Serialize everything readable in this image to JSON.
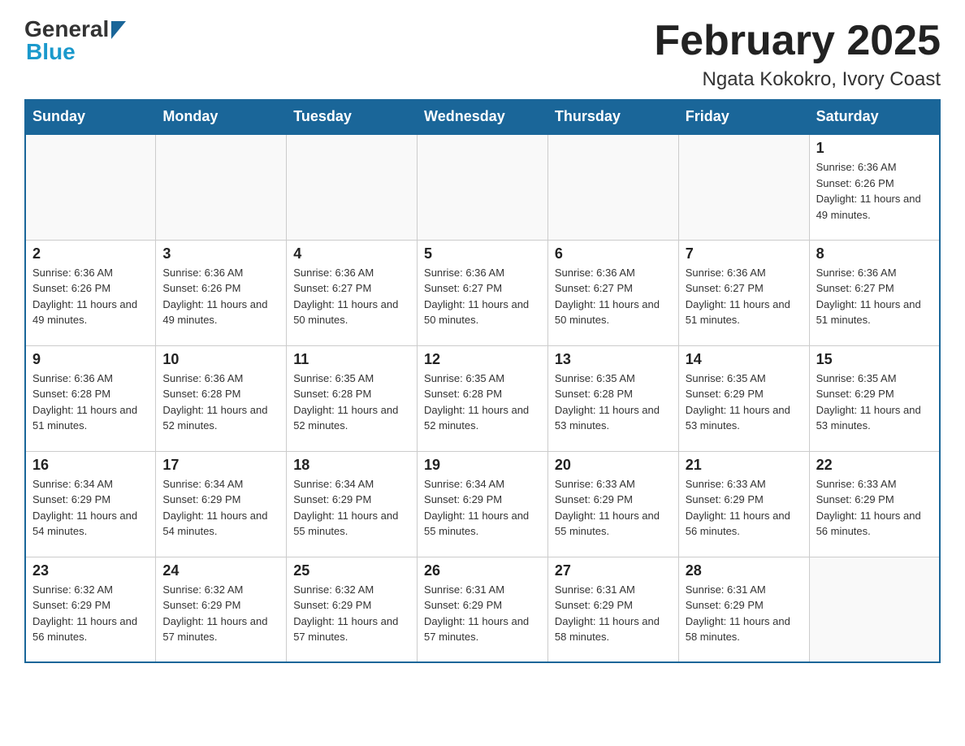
{
  "header": {
    "title": "February 2025",
    "location": "Ngata Kokokro, Ivory Coast"
  },
  "logo": {
    "general": "General",
    "blue": "Blue"
  },
  "days_of_week": [
    "Sunday",
    "Monday",
    "Tuesday",
    "Wednesday",
    "Thursday",
    "Friday",
    "Saturday"
  ],
  "weeks": [
    {
      "days": [
        {
          "number": "",
          "info": ""
        },
        {
          "number": "",
          "info": ""
        },
        {
          "number": "",
          "info": ""
        },
        {
          "number": "",
          "info": ""
        },
        {
          "number": "",
          "info": ""
        },
        {
          "number": "",
          "info": ""
        },
        {
          "number": "1",
          "info": "Sunrise: 6:36 AM\nSunset: 6:26 PM\nDaylight: 11 hours and 49 minutes."
        }
      ]
    },
    {
      "days": [
        {
          "number": "2",
          "info": "Sunrise: 6:36 AM\nSunset: 6:26 PM\nDaylight: 11 hours and 49 minutes."
        },
        {
          "number": "3",
          "info": "Sunrise: 6:36 AM\nSunset: 6:26 PM\nDaylight: 11 hours and 49 minutes."
        },
        {
          "number": "4",
          "info": "Sunrise: 6:36 AM\nSunset: 6:27 PM\nDaylight: 11 hours and 50 minutes."
        },
        {
          "number": "5",
          "info": "Sunrise: 6:36 AM\nSunset: 6:27 PM\nDaylight: 11 hours and 50 minutes."
        },
        {
          "number": "6",
          "info": "Sunrise: 6:36 AM\nSunset: 6:27 PM\nDaylight: 11 hours and 50 minutes."
        },
        {
          "number": "7",
          "info": "Sunrise: 6:36 AM\nSunset: 6:27 PM\nDaylight: 11 hours and 51 minutes."
        },
        {
          "number": "8",
          "info": "Sunrise: 6:36 AM\nSunset: 6:27 PM\nDaylight: 11 hours and 51 minutes."
        }
      ]
    },
    {
      "days": [
        {
          "number": "9",
          "info": "Sunrise: 6:36 AM\nSunset: 6:28 PM\nDaylight: 11 hours and 51 minutes."
        },
        {
          "number": "10",
          "info": "Sunrise: 6:36 AM\nSunset: 6:28 PM\nDaylight: 11 hours and 52 minutes."
        },
        {
          "number": "11",
          "info": "Sunrise: 6:35 AM\nSunset: 6:28 PM\nDaylight: 11 hours and 52 minutes."
        },
        {
          "number": "12",
          "info": "Sunrise: 6:35 AM\nSunset: 6:28 PM\nDaylight: 11 hours and 52 minutes."
        },
        {
          "number": "13",
          "info": "Sunrise: 6:35 AM\nSunset: 6:28 PM\nDaylight: 11 hours and 53 minutes."
        },
        {
          "number": "14",
          "info": "Sunrise: 6:35 AM\nSunset: 6:29 PM\nDaylight: 11 hours and 53 minutes."
        },
        {
          "number": "15",
          "info": "Sunrise: 6:35 AM\nSunset: 6:29 PM\nDaylight: 11 hours and 53 minutes."
        }
      ]
    },
    {
      "days": [
        {
          "number": "16",
          "info": "Sunrise: 6:34 AM\nSunset: 6:29 PM\nDaylight: 11 hours and 54 minutes."
        },
        {
          "number": "17",
          "info": "Sunrise: 6:34 AM\nSunset: 6:29 PM\nDaylight: 11 hours and 54 minutes."
        },
        {
          "number": "18",
          "info": "Sunrise: 6:34 AM\nSunset: 6:29 PM\nDaylight: 11 hours and 55 minutes."
        },
        {
          "number": "19",
          "info": "Sunrise: 6:34 AM\nSunset: 6:29 PM\nDaylight: 11 hours and 55 minutes."
        },
        {
          "number": "20",
          "info": "Sunrise: 6:33 AM\nSunset: 6:29 PM\nDaylight: 11 hours and 55 minutes."
        },
        {
          "number": "21",
          "info": "Sunrise: 6:33 AM\nSunset: 6:29 PM\nDaylight: 11 hours and 56 minutes."
        },
        {
          "number": "22",
          "info": "Sunrise: 6:33 AM\nSunset: 6:29 PM\nDaylight: 11 hours and 56 minutes."
        }
      ]
    },
    {
      "days": [
        {
          "number": "23",
          "info": "Sunrise: 6:32 AM\nSunset: 6:29 PM\nDaylight: 11 hours and 56 minutes."
        },
        {
          "number": "24",
          "info": "Sunrise: 6:32 AM\nSunset: 6:29 PM\nDaylight: 11 hours and 57 minutes."
        },
        {
          "number": "25",
          "info": "Sunrise: 6:32 AM\nSunset: 6:29 PM\nDaylight: 11 hours and 57 minutes."
        },
        {
          "number": "26",
          "info": "Sunrise: 6:31 AM\nSunset: 6:29 PM\nDaylight: 11 hours and 57 minutes."
        },
        {
          "number": "27",
          "info": "Sunrise: 6:31 AM\nSunset: 6:29 PM\nDaylight: 11 hours and 58 minutes."
        },
        {
          "number": "28",
          "info": "Sunrise: 6:31 AM\nSunset: 6:29 PM\nDaylight: 11 hours and 58 minutes."
        },
        {
          "number": "",
          "info": ""
        }
      ]
    }
  ]
}
